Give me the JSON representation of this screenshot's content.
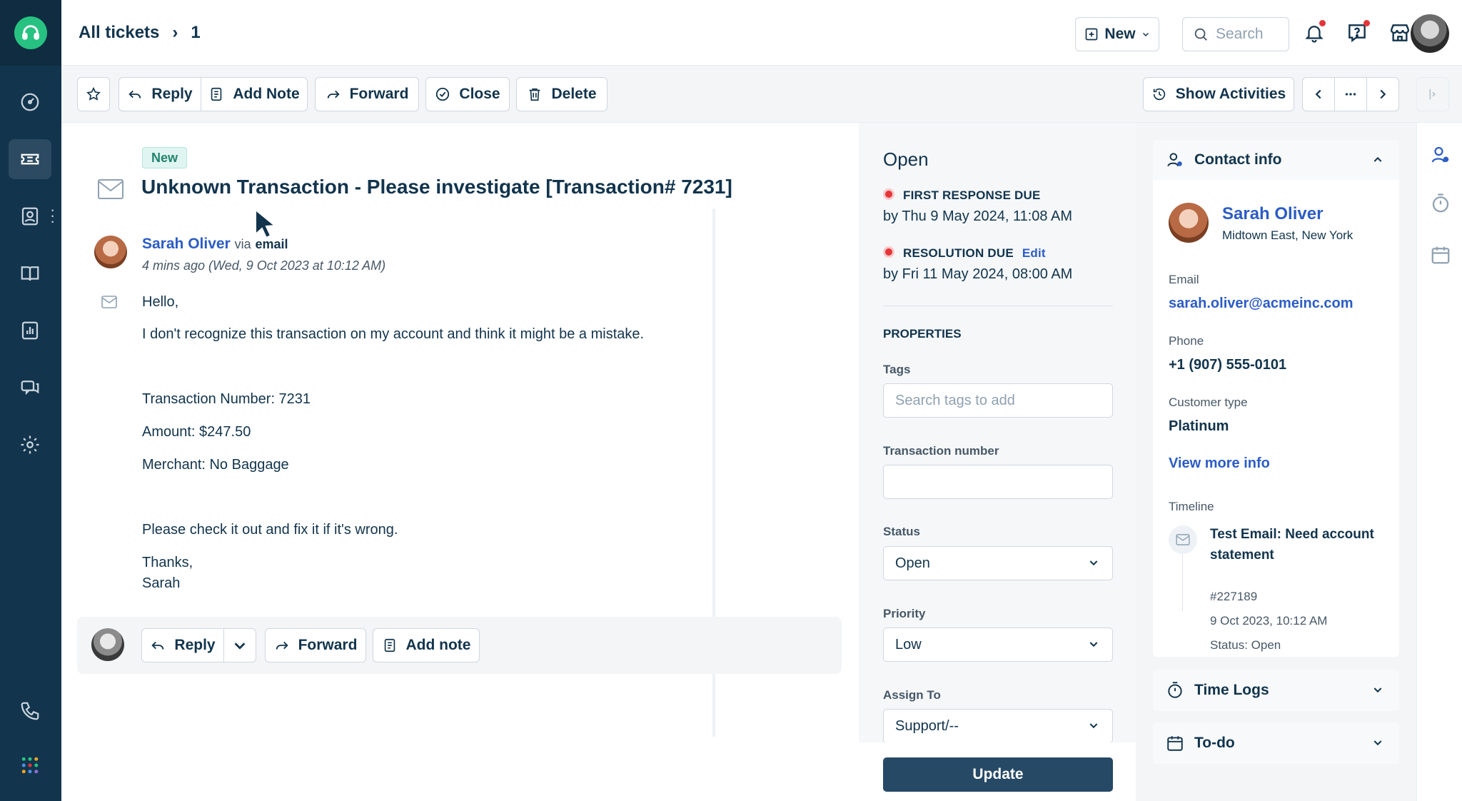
{
  "header": {
    "breadcrumb_root": "All tickets",
    "ticket_id": "1",
    "new_label": "New",
    "search_placeholder": "Search"
  },
  "actions": {
    "reply": "Reply",
    "add_note": "Add Note",
    "forward": "Forward",
    "close": "Close",
    "delete": "Delete",
    "show_activities": "Show Activities"
  },
  "ticket": {
    "badge": "New",
    "subject": "Unknown Transaction - Please investigate [Transaction# 7231]",
    "sender_name": "Sarah Oliver",
    "via_text": "via",
    "source": "email",
    "timestamp": "4 mins ago (Wed, 9 Oct 2023 at 10:12 AM)",
    "body": {
      "greeting": "Hello,",
      "line1": "I don't recognize this transaction on my account and think it might be a mistake.",
      "line2": "Transaction Number: 7231",
      "line3": "Amount: $247.50",
      "line4": "Merchant: No Baggage",
      "line5": "Please check it out and fix it if it's wrong.",
      "line6": "Thanks,",
      "signature": "Sarah"
    }
  },
  "reply_bar": {
    "reply": "Reply",
    "forward": "Forward",
    "add_note": "Add note"
  },
  "properties": {
    "status_title": "Open",
    "first_response_label": "FIRST RESPONSE DUE",
    "first_response_value": "by Thu 9 May 2024, 11:08 AM",
    "resolution_label": "RESOLUTION DUE",
    "resolution_edit": "Edit",
    "resolution_value": "by Fri 11 May 2024, 08:00 AM",
    "heading": "PROPERTIES",
    "tags_label": "Tags",
    "tags_placeholder": "Search tags to add",
    "transaction_label": "Transaction number",
    "transaction_value": "",
    "status_label": "Status",
    "status_value": "Open",
    "priority_label": "Priority",
    "priority_value": "Low",
    "assign_label": "Assign To",
    "assign_value": "Support/--",
    "update_label": "Update"
  },
  "contact": {
    "card_title": "Contact info",
    "name": "Sarah Oliver",
    "location": "Midtown East, New York",
    "email_label": "Email",
    "email": "sarah.oliver@acmeinc.com",
    "phone_label": "Phone",
    "phone": "+1 (907) 555-0101",
    "customer_type_label": "Customer type",
    "customer_type": "Platinum",
    "view_more": "View more info",
    "timeline_label": "Timeline",
    "timeline": {
      "title": "Test Email: Need account statement",
      "id": "#227189",
      "date": "9 Oct 2023, 10:12 AM",
      "status": "Status: Open"
    },
    "time_logs": "Time Logs",
    "todo": "To-do"
  },
  "colors": {
    "nav_bg": "#12344d",
    "brand_green": "#27c281",
    "link_blue": "#2c5cc5",
    "update_btn": "#264966",
    "due_red": "#e43538"
  }
}
